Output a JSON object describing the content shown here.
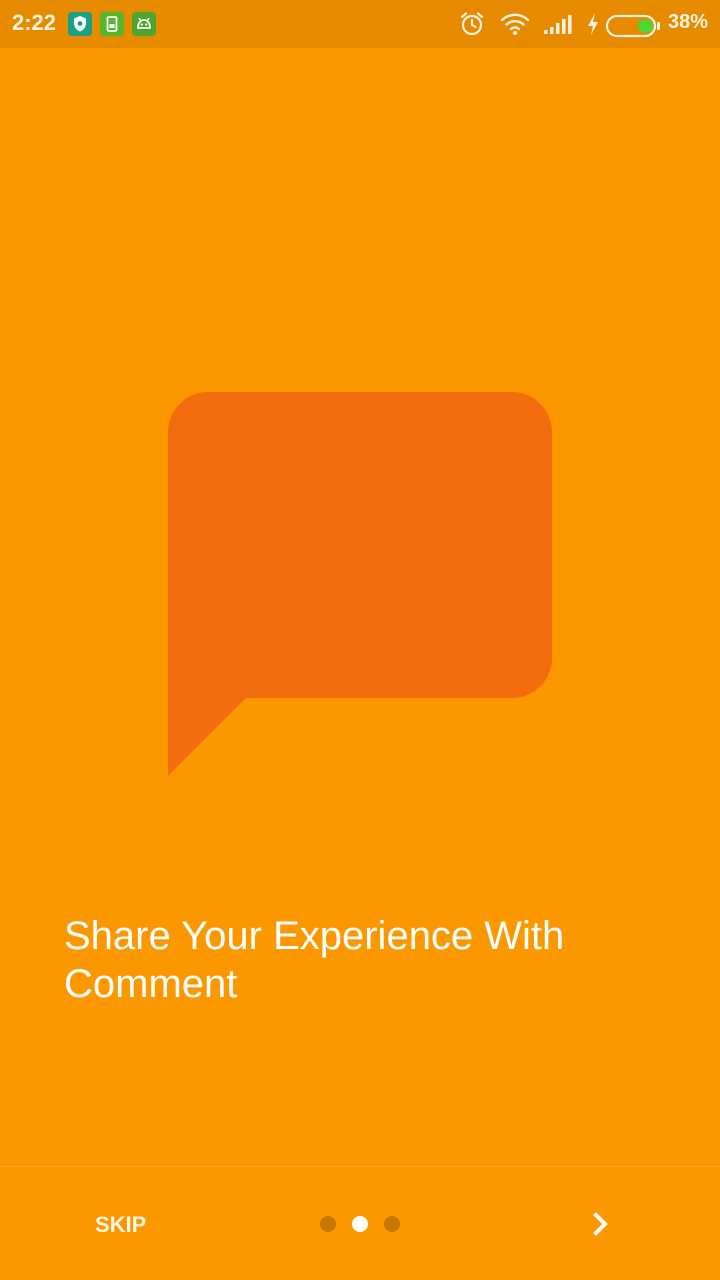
{
  "status_bar": {
    "time": "2:22",
    "battery_percent": "38%",
    "battery_level": 0.38,
    "notification_icons": [
      "shield-app-icon",
      "sim-app-icon",
      "android-app-icon"
    ],
    "status_icons": [
      "alarm-icon",
      "wifi-icon",
      "signal-icon",
      "charging-icon",
      "battery-icon"
    ]
  },
  "onboarding": {
    "illustration": "speech-bubble-icon",
    "title": "Share Your Experience With Comment",
    "page_count": 3,
    "current_page": 2
  },
  "footer": {
    "skip_label": "SKIP",
    "next_icon": "chevron-right-icon"
  },
  "colors": {
    "background": "#fb9800",
    "status_bar": "#e68a00",
    "bubble": "#f36c0d",
    "dot_active": "#ffffff",
    "dot_inactive": "#c47700",
    "text": "#ffffff"
  }
}
